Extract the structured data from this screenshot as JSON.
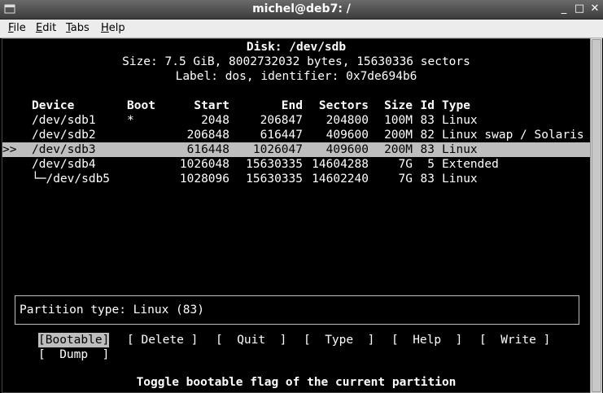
{
  "window": {
    "title": "michel@deb7: /",
    "controls": {
      "minimize": "_",
      "maximize": "□",
      "close": "✕"
    }
  },
  "menubar": {
    "items": [
      {
        "label": "File",
        "underline": "F",
        "rest": "ile"
      },
      {
        "label": "Edit",
        "underline": "E",
        "rest": "dit"
      },
      {
        "label": "Tabs",
        "underline": "T",
        "rest": "abs"
      },
      {
        "label": "Help",
        "underline": "H",
        "rest": "elp"
      }
    ]
  },
  "disk": {
    "title": "Disk: /dev/sdb",
    "size_line": "Size: 7.5 GiB, 8002732032 bytes, 15630336 sectors",
    "label_line": "Label: dos, identifier: 0x7de694b6"
  },
  "table": {
    "headers": {
      "device": "Device",
      "boot": "Boot",
      "start": "Start",
      "end": "End",
      "sectors": "Sectors",
      "size": "Size",
      "id": "Id",
      "type": "Type"
    },
    "selected_marker": ">>",
    "rows": [
      {
        "device": "/dev/sdb1",
        "boot": "*",
        "start": "2048",
        "end": "206847",
        "sectors": "204800",
        "size": "100M",
        "id": "83",
        "type": "Linux",
        "selected": false
      },
      {
        "device": "/dev/sdb2",
        "boot": "",
        "start": "206848",
        "end": "616447",
        "sectors": "409600",
        "size": "200M",
        "id": "82",
        "type": "Linux swap / Solaris",
        "selected": false
      },
      {
        "device": "/dev/sdb3",
        "boot": "",
        "start": "616448",
        "end": "1026047",
        "sectors": "409600",
        "size": "200M",
        "id": "83",
        "type": "Linux",
        "selected": true
      },
      {
        "device": "/dev/sdb4",
        "boot": "",
        "start": "1026048",
        "end": "15630335",
        "sectors": "14604288",
        "size": "7G",
        "id": "5",
        "type": "Extended",
        "selected": false
      },
      {
        "device": "└─/dev/sdb5",
        "boot": "",
        "start": "1028096",
        "end": "15630335",
        "sectors": "14602240",
        "size": "7G",
        "id": "83",
        "type": "Linux",
        "selected": false
      }
    ]
  },
  "info": {
    "text": "Partition type: Linux (83)"
  },
  "actions": {
    "bootable": "[Bootable]",
    "delete": "[ Delete ]",
    "quit": "[  Quit  ]",
    "type": "[  Type  ]",
    "help": "[  Help  ]",
    "write": "[  Write ]",
    "dump": "[  Dump  ]",
    "active": "bootable"
  },
  "helpline": "Toggle bootable flag of the current partition"
}
